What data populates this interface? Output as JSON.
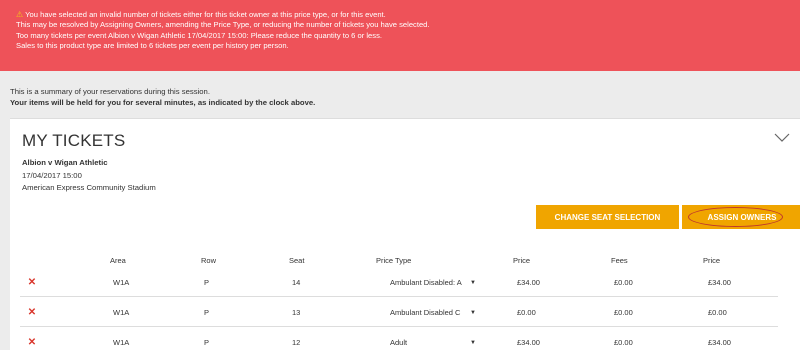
{
  "alert": {
    "lines": [
      "You have selected an invalid number of tickets either for this ticket owner at this price type, or for this event.",
      "This may be resolved by Assigning Owners, amending the Price Type, or reducing the number of tickets you have selected.",
      "Too many tickets per event Albion v Wigan Athletic 17/04/2017 15:00: Please reduce the quantity to 6 or less.",
      "Sales to this product type are limited  to 6 tickets per event per history per person."
    ],
    "warning_icon": "warning-icon"
  },
  "summary": {
    "line1": "This is a summary of your reservations during this session.",
    "line2": "Your items will be held for you for several minutes, as indicated by the clock above."
  },
  "card": {
    "title": "MY TICKETS",
    "event_name": "Albion v Wigan Athletic",
    "event_date": "17/04/2017 15:00",
    "venue": "American Express Community Stadium",
    "change_seat_label": "CHANGE SEAT SELECTION",
    "assign_owners_label": "ASSIGN OWNERS"
  },
  "table": {
    "headers": [
      "Area",
      "Row",
      "Seat",
      "Price Type",
      "Price",
      "Fees",
      "Price"
    ],
    "rows": [
      {
        "area": "W1A",
        "row": "P",
        "seat": "14",
        "price_type": "Ambulant Disabled: A",
        "price": "£34.00",
        "fees": "£0.00",
        "total": "£34.00"
      },
      {
        "area": "W1A",
        "row": "P",
        "seat": "13",
        "price_type": "Ambulant Disabled C",
        "price": "£0.00",
        "fees": "£0.00",
        "total": "£0.00"
      },
      {
        "area": "W1A",
        "row": "P",
        "seat": "12",
        "price_type": "Adult",
        "price": "£34.00",
        "fees": "£0.00",
        "total": "£34.00"
      }
    ]
  },
  "colors": {
    "alert_bg": "#ee5259",
    "button_bg": "#f0a500",
    "delete_icon": "#d9352b",
    "highlight_oval": "#c0392b"
  }
}
